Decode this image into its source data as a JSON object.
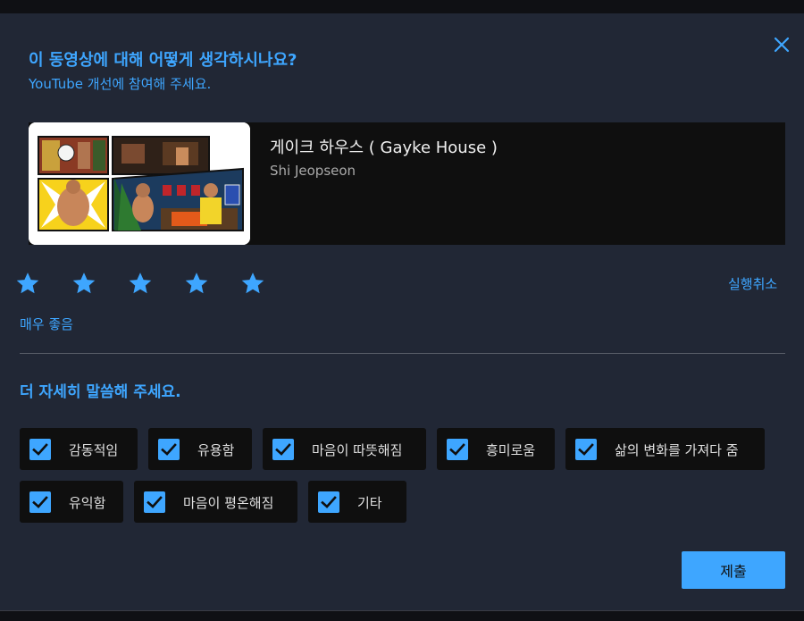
{
  "dialog": {
    "title": "이 동영상에 대해 어떻게 생각하시나요?",
    "subtitle": "YouTube 개선에 참여해 주세요."
  },
  "video": {
    "title": "게이크 하우스 ( Gayke House )",
    "channel": "Shi Jeopseon"
  },
  "rating": {
    "value": 5,
    "max": 5,
    "label": "매우 좋음",
    "undo_label": "실행취소"
  },
  "details": {
    "title": "더 자세히 말씀해 주세요.",
    "options": [
      {
        "label": "감동적임",
        "checked": true
      },
      {
        "label": "유용함",
        "checked": true
      },
      {
        "label": "마음이 따뜻해짐",
        "checked": true
      },
      {
        "label": "흥미로움",
        "checked": true
      },
      {
        "label": "삶의 변화를 가져다 줌",
        "checked": true
      },
      {
        "label": "유익함",
        "checked": true
      },
      {
        "label": "마음이 평온해짐",
        "checked": true
      },
      {
        "label": "기타",
        "checked": true
      }
    ]
  },
  "submit_label": "제출",
  "colors": {
    "accent": "#3ea6ff",
    "dialog_bg": "#212735",
    "chip_bg": "#0f0f0f"
  },
  "icons": {
    "close": "close-icon",
    "star": "star-icon",
    "check": "checkbox-checked-icon"
  }
}
